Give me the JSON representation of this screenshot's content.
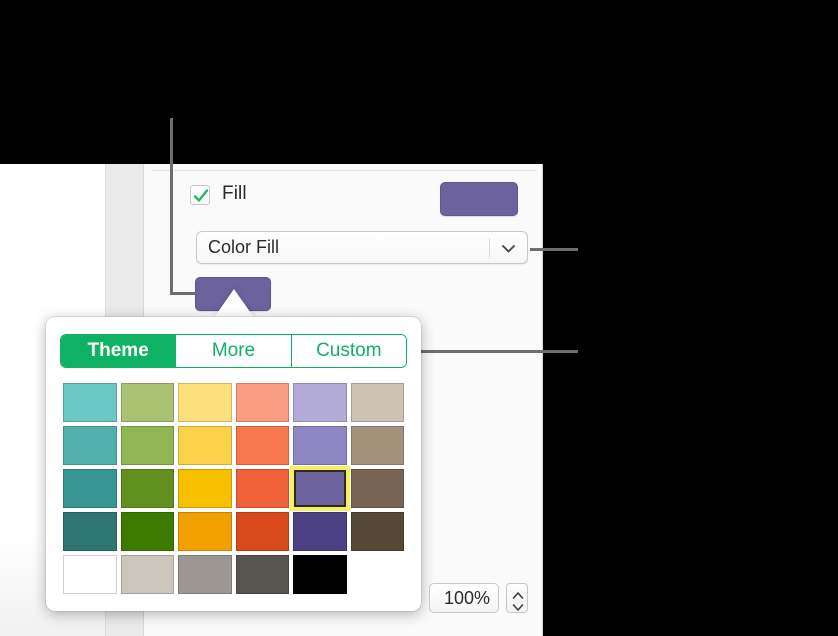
{
  "window": {
    "inspector_background": "#fafafa",
    "canvas_background": "#ffffff",
    "gutter_background": "#eaeaea",
    "backdrop": "#000000"
  },
  "fill_row": {
    "checkbox_checked": true,
    "checkbox_icon": "checkmark-icon",
    "label": "Fill",
    "swatch_color": "#6c629e"
  },
  "fill_type_select": {
    "value": "Color Fill",
    "placeholder": "Color Fill",
    "chevron_icon": "chevron-down-icon"
  },
  "source_swatch": {
    "color": "#6c629e"
  },
  "color_popover": {
    "tabs": [
      {
        "label": "Theme",
        "active": true
      },
      {
        "label": "More",
        "active": false
      },
      {
        "label": "Custom",
        "active": false
      }
    ],
    "accent_color": "#0fb263",
    "selection_ring_color": "#f6ef61",
    "selected_index": 16,
    "columns": 6,
    "rows": 5,
    "swatches": [
      "#69c8c3",
      "#a9c273",
      "#fce07e",
      "#fb9d80",
      "#b3abd8",
      "#cdc2b3",
      "#52b0ad",
      "#8eb652",
      "#fcd24a",
      "#f7784e",
      "#8e87c3",
      "#a4917c",
      "#389694",
      "#62901f",
      "#f7bf00",
      "#ef6239",
      "#6c629e",
      "#766554",
      "#2f7673",
      "#3d7a00",
      "#f2a100",
      "#d84a1c",
      "#4c4185",
      "#554936",
      "#ffffff",
      "#cbc6bb",
      "#9c9792",
      "#585550",
      "#000000",
      ""
    ]
  },
  "zoom_control": {
    "value": "100%",
    "stepper_up_icon": "chevron-up-icon",
    "stepper_down_icon": "chevron-down-icon"
  },
  "callouts": {
    "line_color": "#6e6e6e",
    "targets": [
      "fill-swatch-button",
      "fill-type-popup-menu",
      "custom-tab"
    ]
  }
}
